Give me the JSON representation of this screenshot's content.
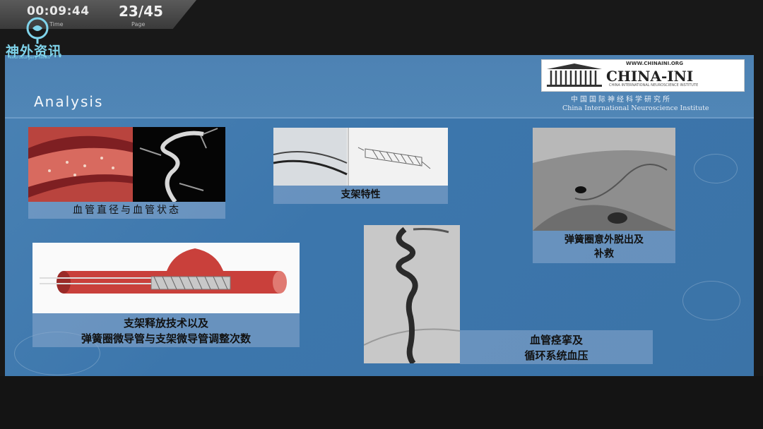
{
  "player": {
    "time": "00:09:44",
    "time_label": "Time",
    "page": "23/45",
    "page_label": "Page"
  },
  "brand": {
    "name": "神外资讯",
    "sub": "Neurosurgery News"
  },
  "slide": {
    "title": "Analysis",
    "institute": {
      "url": "WWW.CHINAINI.ORG",
      "name": "CHINA-INI",
      "tiny": "CHINA INTERNATIONAL NEUROSCIENCE INSTITUTE",
      "name_cn": "中国国际神经科学研究所",
      "name_en": "China International Neuroscience Institute"
    },
    "captions": {
      "vessel": "血管直径与血管状态",
      "stent": "支架特性",
      "coil": "弹簧圈意外脱出及\n补救",
      "release": "支架释放技术以及\n弹簧圈微导管与支架微导管调整次数",
      "spasm": "血管痉挛及\n循环系统血压"
    }
  }
}
